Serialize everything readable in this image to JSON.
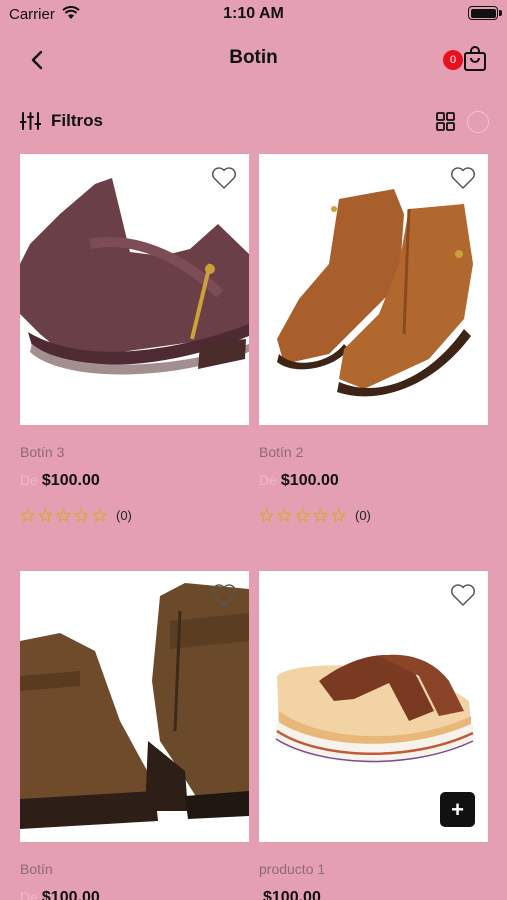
{
  "status_bar": {
    "carrier": "Carrier",
    "time": "1:10 AM"
  },
  "nav": {
    "title": "Botin",
    "cart_count": "0"
  },
  "filters": {
    "label": "Filtros"
  },
  "products": [
    {
      "name": "Botín 3",
      "price_prefix": "De",
      "price": "$100.00",
      "rating_count": "(0)"
    },
    {
      "name": "Botín 2",
      "price_prefix": "De",
      "price": "$100.00",
      "rating_count": "(0)"
    },
    {
      "name": "Botín",
      "price_prefix": "De",
      "price": "$100.00",
      "rating_count": ""
    },
    {
      "name": "producto 1",
      "price_prefix": "",
      "price": "$100.00",
      "rating_count": ""
    }
  ],
  "colors": {
    "background": "#e59fb2",
    "badge": "#e8101e",
    "star": "#d7a743"
  },
  "icons": [
    "back-chevron-icon",
    "shopping-bag-icon",
    "sliders-icon",
    "grid-view-icon",
    "heart-icon",
    "star-icon",
    "plus-icon",
    "wifi-icon",
    "battery-icon"
  ]
}
